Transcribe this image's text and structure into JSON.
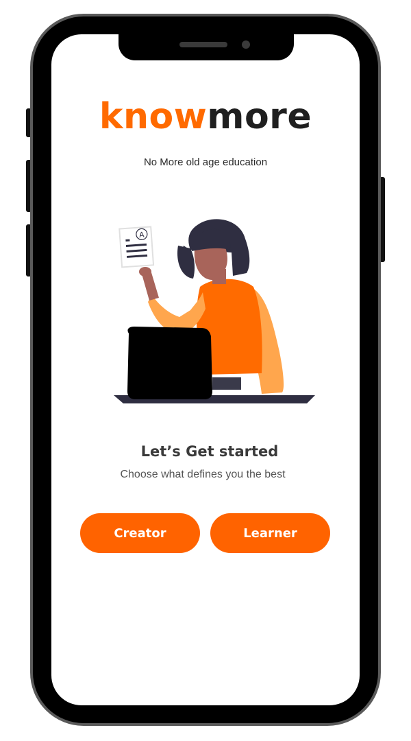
{
  "app": {
    "logo_part1": "know",
    "logo_part2": "more",
    "tagline": "No More old age education"
  },
  "illustration": {
    "icon": "woman-with-laptop-illustration",
    "document_badge": "A"
  },
  "onboarding": {
    "heading": "Let’s Get started",
    "subheading": "Choose what defines you the best",
    "buttons": {
      "creator_label": "Creator",
      "learner_label": "Learner"
    }
  },
  "colors": {
    "brand_orange": "#ff6300",
    "logo_dark": "#1f1f1f",
    "illustration_orange": "#ff6b00",
    "illustration_skin": "#a8645a",
    "illustration_hair": "#2f2e41"
  }
}
